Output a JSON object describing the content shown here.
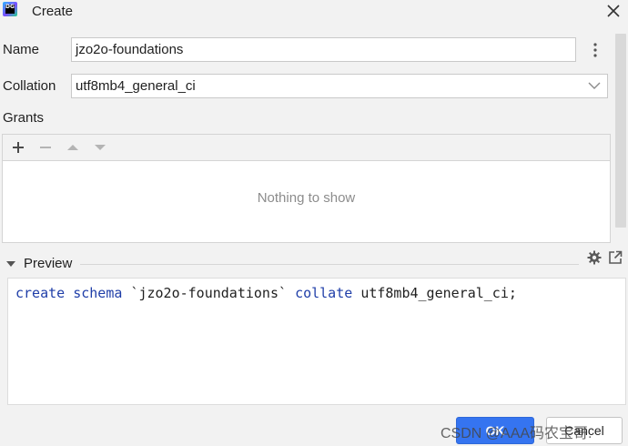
{
  "window": {
    "title": "Create"
  },
  "form": {
    "name_label": "Name",
    "name_value": "jzo2o-foundations",
    "collation_label": "Collation",
    "collation_value": "utf8mb4_general_ci",
    "grants_label": "Grants"
  },
  "grants": {
    "empty_text": "Nothing to show",
    "toolbar_icons": [
      "add-icon",
      "remove-icon",
      "move-up-icon",
      "move-down-icon"
    ]
  },
  "preview": {
    "label": "Preview",
    "code": {
      "kw1": "create",
      "kw2": "schema",
      "ident": "`jzo2o-foundations`",
      "kw3": "collate",
      "tail": "utf8mb4_general_ci;"
    }
  },
  "buttons": {
    "ok": "OK",
    "cancel": "Cancel"
  },
  "watermark": "CSDN @AAA码农宝哥.",
  "colors": {
    "accent": "#3574f0",
    "keyword": "#1f3ea8",
    "muted": "#8c8c8c"
  }
}
